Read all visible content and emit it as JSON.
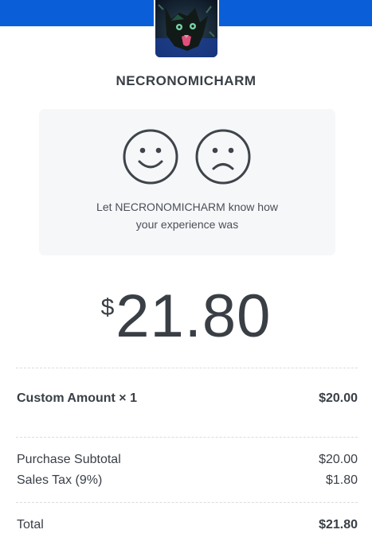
{
  "brand": {
    "header_color": "#0a5fd9"
  },
  "merchant": {
    "name": "NECRONOMICHARM",
    "avatar_icon": "cat-photo-avatar"
  },
  "feedback": {
    "positive_icon": "smiley-face-icon",
    "negative_icon": "frowny-face-icon",
    "prompt_line1": "Let NECRONOMICHARM know how",
    "prompt_line2": "your experience was"
  },
  "payment": {
    "currency_symbol": "$",
    "total_amount": "21.80"
  },
  "line_items": [
    {
      "label": "Custom Amount × 1",
      "amount": "$20.00"
    }
  ],
  "summary": {
    "subtotal_label": "Purchase Subtotal",
    "subtotal_value": "$20.00",
    "tax_label": "Sales Tax (9%)",
    "tax_value": "$1.80",
    "total_label": "Total",
    "total_value": "$21.80"
  }
}
